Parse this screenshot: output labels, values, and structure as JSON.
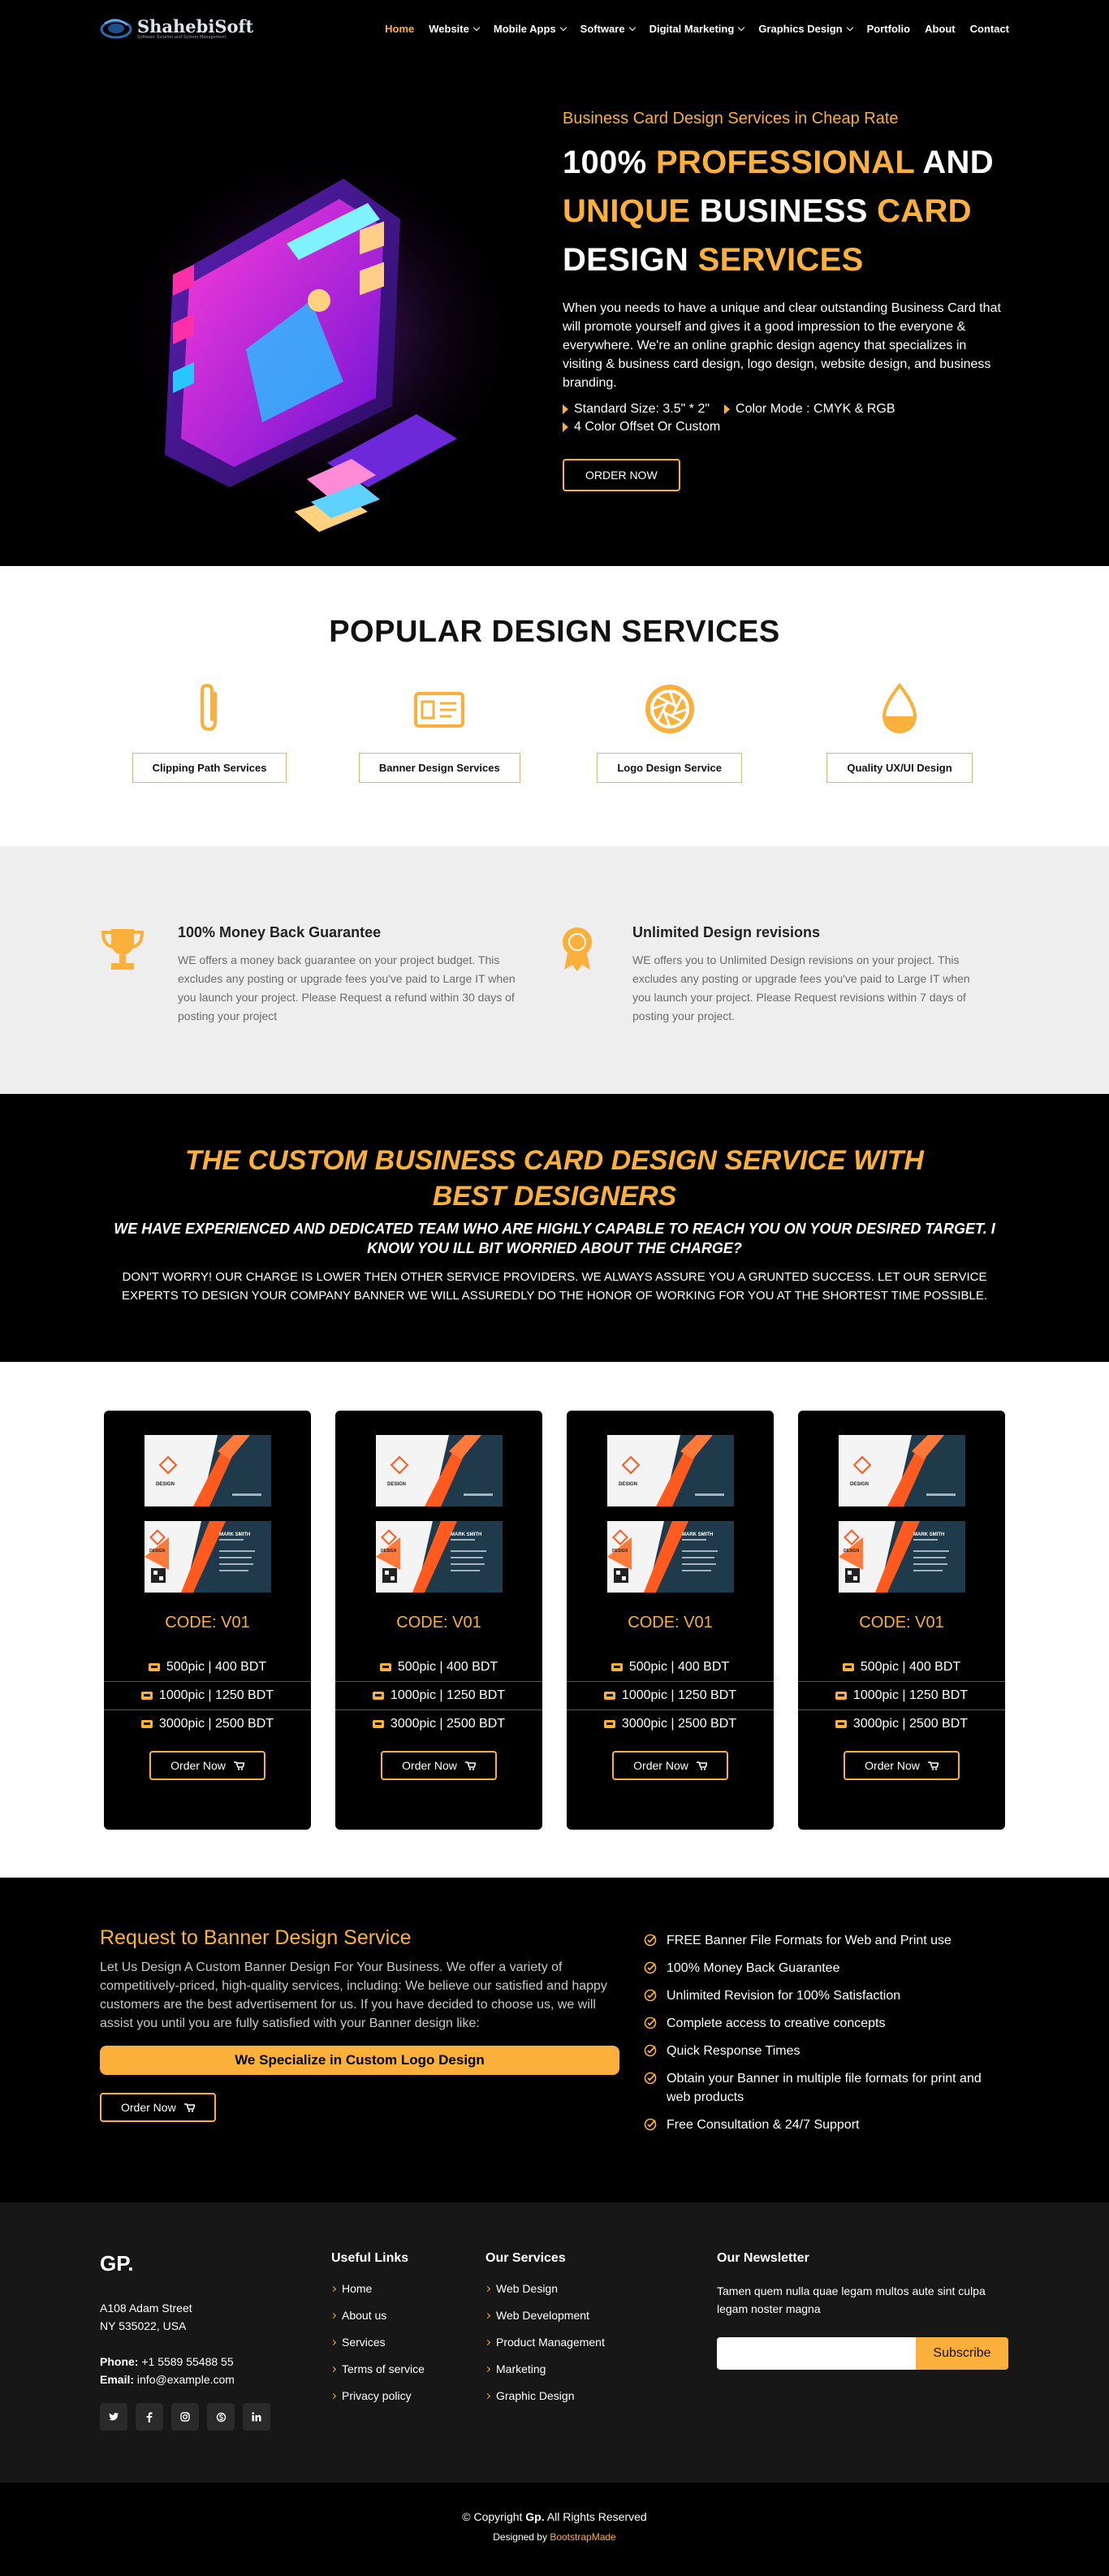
{
  "brand": {
    "name": "ShahebiSoft",
    "tagline": "Software Solution and System Management"
  },
  "nav": [
    {
      "label": "Home",
      "active": true,
      "dropdown": false
    },
    {
      "label": "Website",
      "active": false,
      "dropdown": true
    },
    {
      "label": "Mobile Apps",
      "active": false,
      "dropdown": true
    },
    {
      "label": "Software",
      "active": false,
      "dropdown": true
    },
    {
      "label": "Digital Marketing",
      "active": false,
      "dropdown": true
    },
    {
      "label": "Graphics Design",
      "active": false,
      "dropdown": true
    },
    {
      "label": "Portfolio",
      "active": false,
      "dropdown": false
    },
    {
      "label": "About",
      "active": false,
      "dropdown": false
    },
    {
      "label": "Contact",
      "active": false,
      "dropdown": false
    }
  ],
  "hero": {
    "kicker": "Business Card Design Services in Cheap Rate",
    "title_1w": "100%",
    "title_1g": "PROFESSIONAL",
    "title_1w2": "AND",
    "title_2g": "UNIQUE",
    "title_2w": "BUSINESS",
    "title_2g2": "CARD",
    "title_3w": "DESIGN",
    "title_3g": "SERVICES",
    "description": "When you needs to have a unique and clear outstanding Business Card that will promote yourself and gives it a good impression to the everyone & everywhere. We're an online graphic design agency that specializes in visiting & business card design, logo design, website design, and business branding.",
    "bullets": [
      "Standard Size: 3.5\" * 2\"",
      "Color Mode : CMYK & RGB",
      "4 Color Offset Or Custom"
    ],
    "cta": "ORDER NOW"
  },
  "services": {
    "title": "POPULAR DESIGN SERVICES",
    "items": [
      {
        "label": "Clipping Path Services",
        "icon": "paperclip-icon"
      },
      {
        "label": "Banner Design Services",
        "icon": "id-card-icon"
      },
      {
        "label": "Logo Design Service",
        "icon": "aperture-icon"
      },
      {
        "label": "Quality UX/UI Design",
        "icon": "droplet-icon"
      }
    ]
  },
  "guarantees": [
    {
      "title": "100% Money Back Guarantee",
      "icon": "trophy-icon",
      "text": "WE offers a money back guarantee on your project budget. This excludes any posting or upgrade fees you've paid to Large IT when you launch your project. Please Request a refund within 30 days of posting your project"
    },
    {
      "title": "Unlimited Design revisions",
      "icon": "award-badge-icon",
      "text": "WE offers you to Unlimited Design revisions on your project. This excludes any posting or upgrade fees you've paid to Large IT when you launch your project. Please Request revisions within 7 days of posting your project."
    }
  ],
  "custom": {
    "title": "THE CUSTOM BUSINESS CARD DESIGN SERVICE WITH BEST DESIGNERS",
    "subtitle": "WE HAVE EXPERIENCED AND DEDICATED TEAM WHO ARE HIGHLY CAPABLE TO REACH YOU ON YOUR DESIRED TARGET. I KNOW YOU ILL BIT WORRIED ABOUT THE CHARGE?",
    "text": "DON'T WORRY! OUR CHARGE IS LOWER THEN OTHER SERVICE PROVIDERS. WE ALWAYS ASSURE YOU A GRUNTED SUCCESS. LET OUR SERVICE EXPERTS TO DESIGN YOUR COMPANY BANNER WE WILL ASSUREDLY DO THE HONOR OF WORKING FOR YOU AT THE SHORTEST TIME POSSIBLE."
  },
  "pricing": [
    {
      "code": "CODE: V01",
      "tiers": [
        "500pic | 400 BDT",
        "1000pic | 1250 BDT",
        "3000pic | 2500 BDT"
      ],
      "button": "Order Now"
    },
    {
      "code": "CODE: V01",
      "tiers": [
        "500pic | 400 BDT",
        "1000pic | 1250 BDT",
        "3000pic | 2500 BDT"
      ],
      "button": "Order Now"
    },
    {
      "code": "CODE: V01",
      "tiers": [
        "500pic | 400 BDT",
        "1000pic | 1250 BDT",
        "3000pic | 2500 BDT"
      ],
      "button": "Order Now"
    },
    {
      "code": "CODE: V01",
      "tiers": [
        "500pic | 400 BDT",
        "1000pic | 1250 BDT",
        "3000pic | 2500 BDT"
      ],
      "button": "Order Now"
    }
  ],
  "card_mock": {
    "logo_text": "DESIGN",
    "name_text": "MARK SMITH"
  },
  "request": {
    "title": "Request to Banner Design Service",
    "text": "Let Us Design A Custom Banner Design For Your Business. We offer a variety of competitively-priced, high-quality services, including: We believe our satisfied and happy customers are the best advertisement for us. If you have decided to choose us, we will assist you until you are fully satisfied with your Banner design like:",
    "banner": "We Specialize in Custom Logo Design",
    "button": "Order Now",
    "features": [
      "FREE Banner File Formats for Web and Print use",
      "100% Money Back Guarantee",
      "Unlimited Revision for 100% Satisfaction",
      "Complete access to creative concepts",
      "Quick Response Times",
      "Obtain your Banner in multiple file formats for print and web products",
      "Free Consultation & 24/7 Support"
    ]
  },
  "footer": {
    "brand": "GP.",
    "address_1": "A108 Adam Street",
    "address_2": "NY 535022, USA",
    "phone_label": "Phone:",
    "phone": "+1 5589 55488 55",
    "email_label": "Email:",
    "email": "info@example.com",
    "socials": [
      "twitter-icon",
      "facebook-icon",
      "instagram-icon",
      "skype-icon",
      "linkedin-icon"
    ],
    "useful_links_title": "Useful Links",
    "useful_links": [
      "Home",
      "About us",
      "Services",
      "Terms of service",
      "Privacy policy"
    ],
    "services_title": "Our Services",
    "services": [
      "Web Design",
      "Web Development",
      "Product Management",
      "Marketing",
      "Graphic Design"
    ],
    "newsletter_title": "Our Newsletter",
    "newsletter_text": "Tamen quem nulla quae legam multos aute sint culpa legam noster magna",
    "subscribe": "Subscribe"
  },
  "copyright": {
    "prefix": "© Copyright",
    "brand": "Gp.",
    "suffix": "All Rights Reserved",
    "designed_prefix": "Designed by",
    "designed_by": "BootstrapMade"
  },
  "colors": {
    "accent": "#fbb03b",
    "dark": "#000000",
    "footer": "#171717",
    "light_section": "#eeeeee"
  }
}
